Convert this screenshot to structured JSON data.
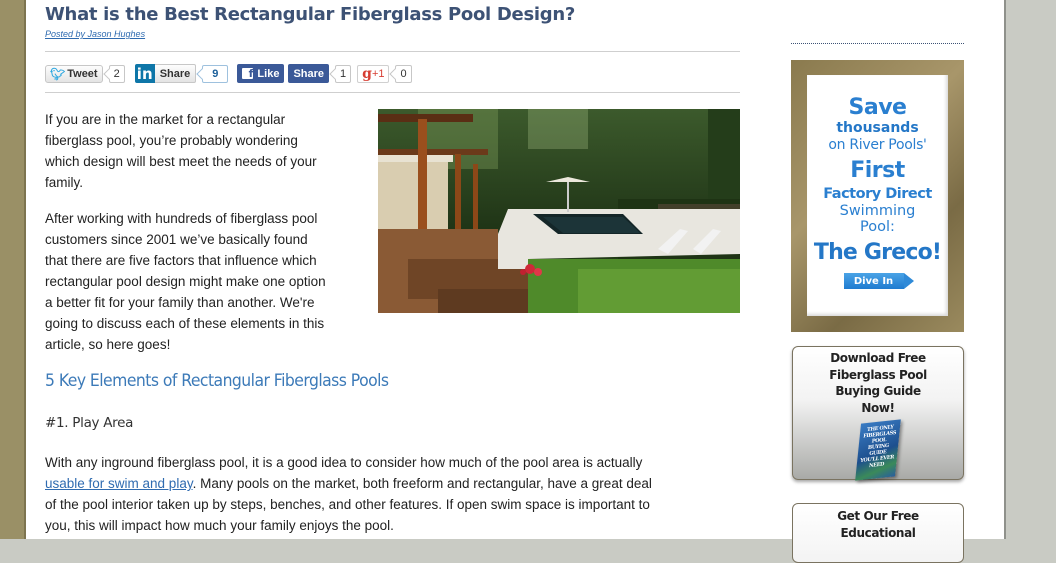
{
  "article": {
    "title": "What is the Best Rectangular Fiberglass Pool Design?",
    "byline": "Posted by Jason Hughes",
    "intro_paragraphs": [
      [
        "If you are in the market for a rectangular",
        "fiberglass pool, you’re probably wondering",
        "which design will best meet the needs of your",
        "family."
      ],
      [
        "After working with hundreds of fiberglass pool",
        "customers since 2001 we’ve basically found",
        "that there are five factors that influence which",
        "rectangular pool design might make one option",
        "a better fit for your family than another.  We're",
        "going to discuss each of these elements in this",
        "article, so here goes!"
      ]
    ],
    "section_heading": "5 Key Elements of Rectangular Fiberglass Pools",
    "subheading": "#1.  Play Area",
    "body": {
      "line1": "With any inground fiberglass pool, it is a good idea to consider how much of the pool area is actually",
      "link_text": "usable for swim and play",
      "line2_rest": ".  Many pools on the market, both freeform and rectangular, have a great deal",
      "line3": "of the pool interior taken up by steps, benches, and other features.  If open swim space is important to",
      "line4": "you, this will impact how much your family enjoys the pool."
    },
    "image_alt": "rectangular fiberglass pool with wood deck and pergola"
  },
  "social": {
    "tweet_label": "Tweet",
    "tweet_count": "2",
    "linkedin_logo": "in",
    "linkedin_label": "Share",
    "linkedin_count": "9",
    "fb_like_label": "Like",
    "fb_share_label": "Share",
    "fb_count": "1",
    "gplus_g": "g",
    "gplus_label": "+1",
    "gplus_count": "0"
  },
  "sidebar": {
    "ad": {
      "line1": "Save",
      "line2": "thousands",
      "line3": "on River Pools'",
      "line4": "First",
      "line5": "Factory Direct",
      "line6a": "Swimming",
      "line6b": "Pool:",
      "line7": "The Greco!",
      "cta": "Dive In"
    },
    "guide": {
      "lines": [
        "Download Free",
        "Fiberglass Pool",
        "Buying Guide",
        "Now!"
      ],
      "book_text": "THE ONLY FIBERGLASS POOL BUYING GUIDE YOU'LL EVER NEED"
    },
    "guide2": {
      "lines": [
        "Get Our Free",
        "Educational"
      ]
    }
  },
  "colors": {
    "title": "#3d5275",
    "link": "#2f6bb0",
    "section_heading": "#3c7ab8",
    "ad_blue": "#2a7fd0",
    "facebook": "#3b5998",
    "linkedin": "#0e76a8",
    "twitter": "#2ca7e0",
    "gplus": "#d73d32"
  }
}
